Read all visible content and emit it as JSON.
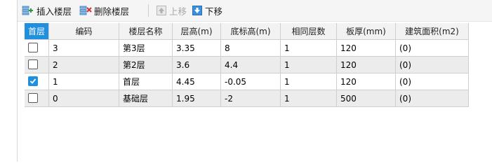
{
  "toolbar": {
    "insert_label": "插入楼层",
    "delete_label": "删除楼层",
    "up_label": "上移",
    "down_label": "下移"
  },
  "table": {
    "headers": [
      "首层",
      "编码",
      "楼层名称",
      "层高(m)",
      "底标高(m)",
      "相同层数",
      "板厚(mm)",
      "建筑面积(m2)"
    ],
    "rows": [
      {
        "checked": false,
        "code": "3",
        "name": "第3层",
        "height": "3.35",
        "base": "8",
        "same": "1",
        "thick": "120",
        "area": "(0)"
      },
      {
        "checked": false,
        "code": "2",
        "name": "第2层",
        "height": "3.6",
        "base": "4.4",
        "same": "1",
        "thick": "120",
        "area": "(0)"
      },
      {
        "checked": true,
        "code": "1",
        "name": "首层",
        "height": "4.45",
        "base": "-0.05",
        "same": "1",
        "thick": "120",
        "area": "(0)"
      },
      {
        "checked": false,
        "code": "0",
        "name": "基础层",
        "height": "1.95",
        "base": "-2",
        "same": "1",
        "thick": "500",
        "area": "(0)"
      }
    ]
  },
  "colors": {
    "accent": "#1f8fde",
    "header_bg": "#f2f2f2",
    "row_alt_bg": "#ececec"
  }
}
